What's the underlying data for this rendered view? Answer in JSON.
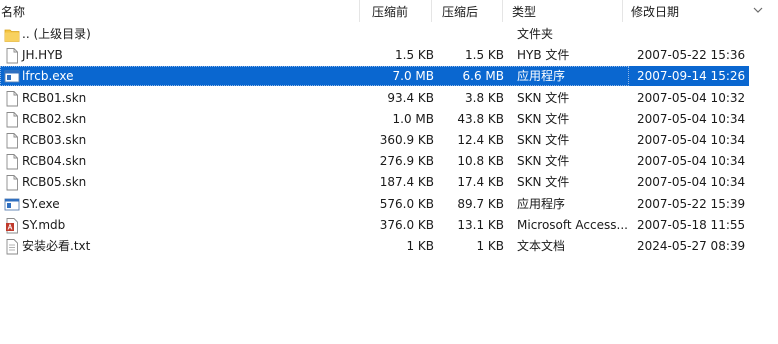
{
  "header": {
    "name_label": "名称",
    "compressed_before_label": "压缩前",
    "compressed_after_label": "压缩后",
    "type_label": "类型",
    "modified_label": "修改日期"
  },
  "files": [
    {
      "name": ".. (上级目录)",
      "size_before": "",
      "size_after": "",
      "type": "文件夹",
      "date": "",
      "icon": "folder-icon"
    },
    {
      "name": "JH.HYB",
      "size_before": "1.5 KB",
      "size_after": "1.5 KB",
      "type": "HYB 文件",
      "date": "2007-05-22 15:36",
      "icon": "file-icon"
    },
    {
      "name": "lfrcb.exe",
      "size_before": "7.0 MB",
      "size_after": "6.6 MB",
      "type": "应用程序",
      "date": "2007-09-14 15:26",
      "icon": "exe-icon",
      "selected": true
    },
    {
      "name": "RCB01.skn",
      "size_before": "93.4 KB",
      "size_after": "3.8 KB",
      "type": "SKN 文件",
      "date": "2007-05-04 10:32",
      "icon": "file-icon"
    },
    {
      "name": "RCB02.skn",
      "size_before": "1.0 MB",
      "size_after": "43.8 KB",
      "type": "SKN 文件",
      "date": "2007-05-04 10:34",
      "icon": "file-icon"
    },
    {
      "name": "RCB03.skn",
      "size_before": "360.9 KB",
      "size_after": "12.4 KB",
      "type": "SKN 文件",
      "date": "2007-05-04 10:34",
      "icon": "file-icon"
    },
    {
      "name": "RCB04.skn",
      "size_before": "276.9 KB",
      "size_after": "10.8 KB",
      "type": "SKN 文件",
      "date": "2007-05-04 10:34",
      "icon": "file-icon"
    },
    {
      "name": "RCB05.skn",
      "size_before": "187.4 KB",
      "size_after": "17.4 KB",
      "type": "SKN 文件",
      "date": "2007-05-04 10:34",
      "icon": "file-icon"
    },
    {
      "name": "SY.exe",
      "size_before": "576.0 KB",
      "size_after": "89.7 KB",
      "type": "应用程序",
      "date": "2007-05-22 15:39",
      "icon": "exe-icon"
    },
    {
      "name": "SY.mdb",
      "size_before": "376.0 KB",
      "size_after": "13.1 KB",
      "type": "Microsoft Access...",
      "date": "2007-05-18 11:55",
      "icon": "access-db-icon"
    },
    {
      "name": "安装必看.txt",
      "size_before": "1 KB",
      "size_after": "1 KB",
      "type": "文本文档",
      "date": "2024-05-27 08:39",
      "icon": "text-file-icon"
    }
  ],
  "colors": {
    "selection": "#0a67d0",
    "folder": "#f5c542",
    "exe_blue": "#2f6fc0",
    "access_red": "#c0392b"
  }
}
